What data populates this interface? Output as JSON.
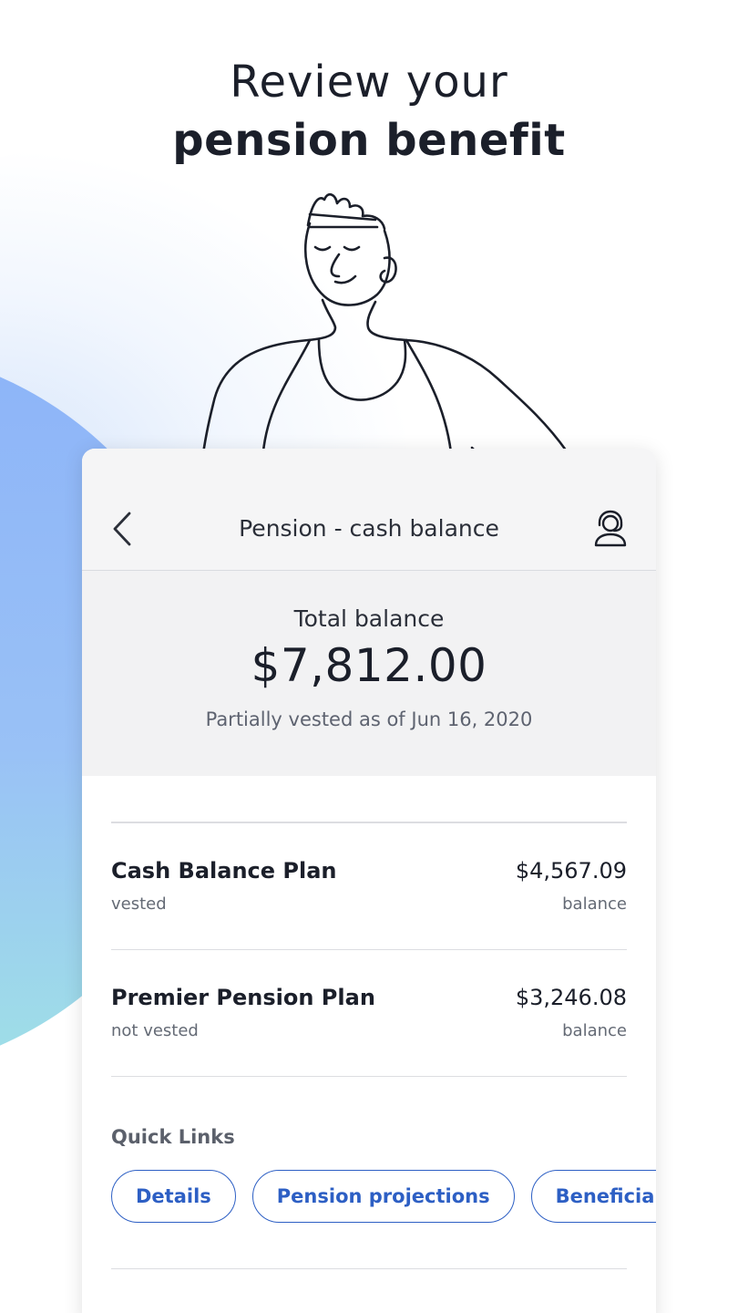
{
  "headline": {
    "line1": "Review your",
    "line2": "pension benefit"
  },
  "screen": {
    "title": "Pension - cash balance",
    "back_icon": "chevron-left-icon",
    "support_icon": "headset-support-icon"
  },
  "summary": {
    "label": "Total balance",
    "amount": "$7,812.00",
    "subtitle": "Partially vested as of Jun 16, 2020"
  },
  "plans": [
    {
      "name": "Cash Balance Plan",
      "status": "vested",
      "amount": "$4,567.09",
      "caption": "balance"
    },
    {
      "name": "Premier Pension Plan",
      "status": "not vested",
      "amount": "$3,246.08",
      "caption": "balance"
    }
  ],
  "quick_links": {
    "title": "Quick Links",
    "items": [
      "Details",
      "Pension projections",
      "Beneficiaries"
    ]
  },
  "colors": {
    "accent": "#2d5fc4",
    "blob_top": "#8db4f8",
    "blob_bottom": "#9fe0e6"
  }
}
